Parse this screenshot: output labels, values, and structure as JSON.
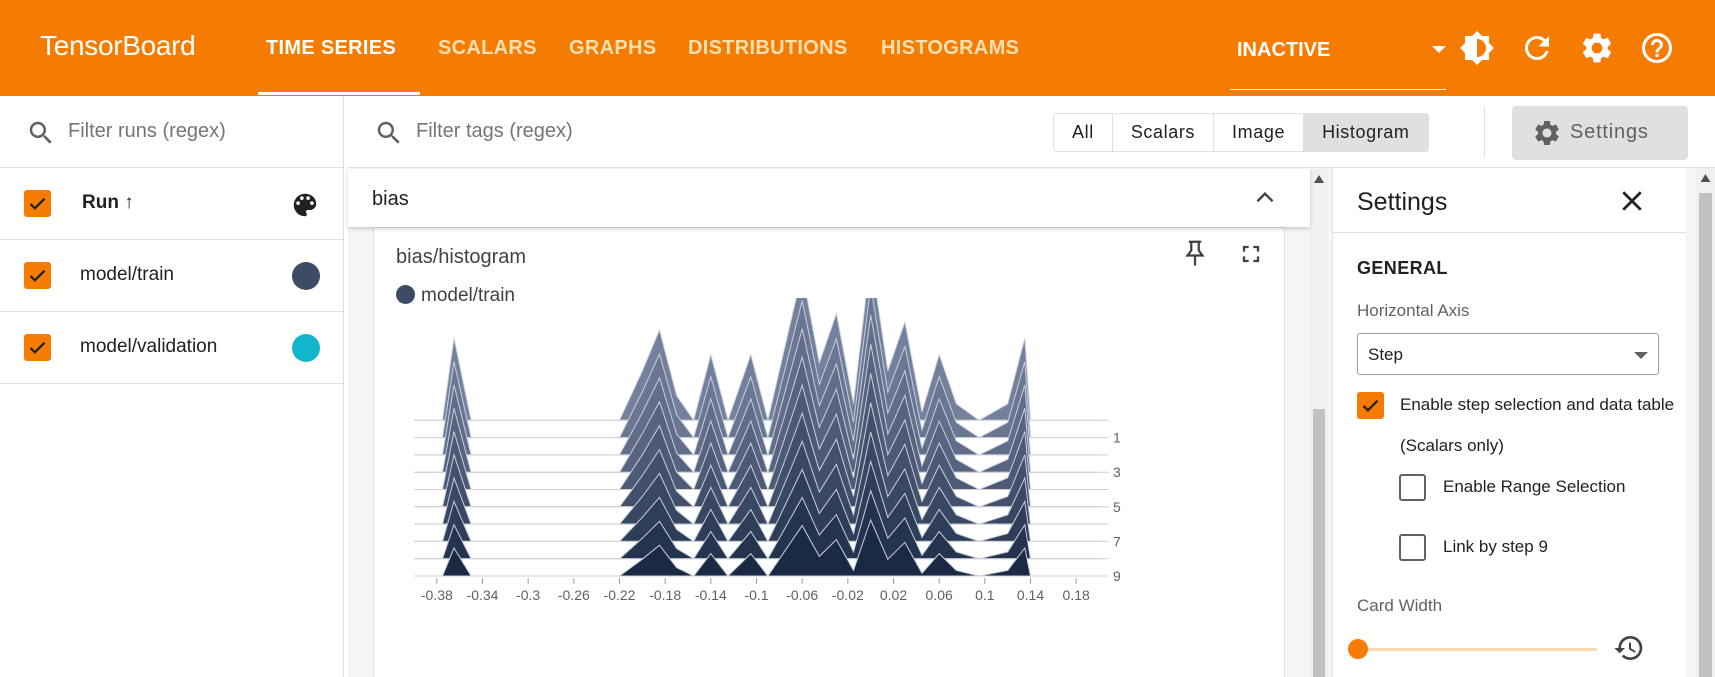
{
  "app": {
    "brand": "TensorBoard"
  },
  "nav": {
    "tabs": [
      {
        "label": "TIME SERIES",
        "active": true
      },
      {
        "label": "SCALARS"
      },
      {
        "label": "GRAPHS"
      },
      {
        "label": "DISTRIBUTIONS"
      },
      {
        "label": "HISTOGRAMS"
      }
    ],
    "plugin_select": "INACTIVE"
  },
  "colors": {
    "brand": "#f57c00",
    "train": "#3d4b66",
    "validation": "#12b5cb"
  },
  "runs": {
    "filter_placeholder": "Filter runs (regex)",
    "header_label": "Run ↑",
    "items": [
      {
        "label": "model/train",
        "color": "#3d4b66",
        "checked": true
      },
      {
        "label": "model/validation",
        "color": "#12b5cb",
        "checked": true
      }
    ]
  },
  "toolbar": {
    "filter_placeholder": "Filter tags (regex)",
    "type_filters": [
      "All",
      "Scalars",
      "Image",
      "Histogram"
    ],
    "selected_filter": "Histogram",
    "settings_label": "Settings"
  },
  "group": {
    "name": "bias"
  },
  "card": {
    "title": "bias/histogram",
    "legend": "model/train"
  },
  "chart_data": {
    "type": "area",
    "title": "bias/histogram",
    "x_ticks": [
      "-0.38",
      "-0.34",
      "-0.3",
      "-0.26",
      "-0.22",
      "-0.18",
      "-0.14",
      "-0.1",
      "-0.06",
      "-0.02",
      "0.02",
      "0.06",
      "0.1",
      "0.14",
      "0.18"
    ],
    "y_ticks": [
      "1",
      "3",
      "5",
      "7",
      "9"
    ],
    "xlim": [
      -0.4,
      0.2
    ],
    "steps": [
      9,
      8,
      7,
      6,
      5,
      4,
      3,
      2,
      1,
      0
    ],
    "series": [
      {
        "name": "model/train",
        "color": "#3d4b66"
      }
    ]
  },
  "settings_panel": {
    "title": "Settings",
    "section": "GENERAL",
    "horizontal_axis_label": "Horizontal Axis",
    "horizontal_axis_value": "Step",
    "step_selection_label": "Enable step selection and data table",
    "step_selection_note": "(Scalars only)",
    "range_selection_label": "Enable Range Selection",
    "link_by_step_label": "Link by step 9",
    "card_width_label": "Card Width"
  }
}
